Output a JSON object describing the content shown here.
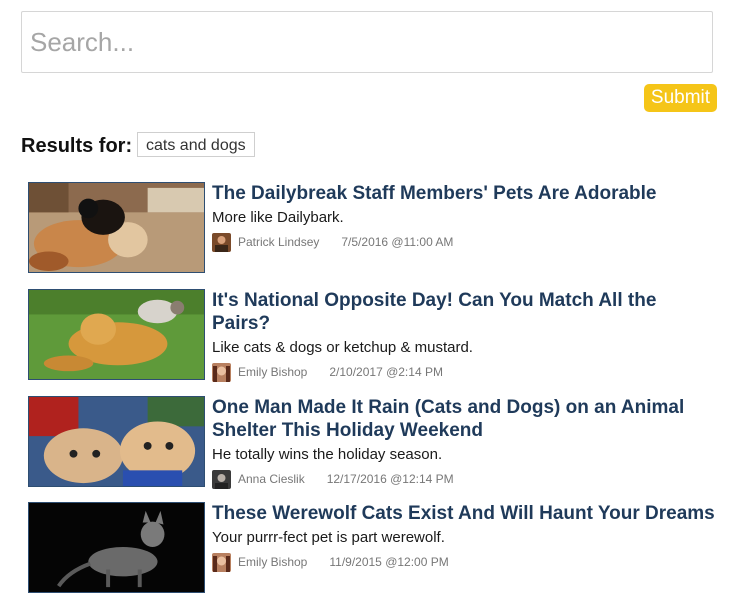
{
  "search": {
    "placeholder": "Search...",
    "value": ""
  },
  "submit_label": "Submit",
  "results_for_label": "Results for:",
  "query": "cats and dogs",
  "results": [
    {
      "title": "The Dailybreak Staff Members' Pets Are Adorable",
      "subtitle": "More like Dailybark.",
      "author": "Patrick Lindsey",
      "date": "7/5/2016 @11:00 AM"
    },
    {
      "title": "It's National Opposite Day! Can You Match All the Pairs?",
      "subtitle": "Like cats & dogs or ketchup & mustard.",
      "author": "Emily Bishop",
      "date": "2/10/2017 @2:14 PM"
    },
    {
      "title": "One Man Made It Rain (Cats and Dogs) on an Animal Shelter This Holiday Weekend",
      "subtitle": "He totally wins the holiday season.",
      "author": "Anna Cieslik",
      "date": "12/17/2016 @12:14 PM"
    },
    {
      "title": "These Werewolf Cats Exist And Will Haunt Your Dreams",
      "subtitle": "Your purrr-fect pet is part werewolf.",
      "author": "Emily Bishop",
      "date": "11/9/2015 @12:00 PM"
    }
  ],
  "colors": {
    "accent": "#f5c518",
    "title": "#1f3a5a",
    "thumb_border": "#2e4e72"
  }
}
